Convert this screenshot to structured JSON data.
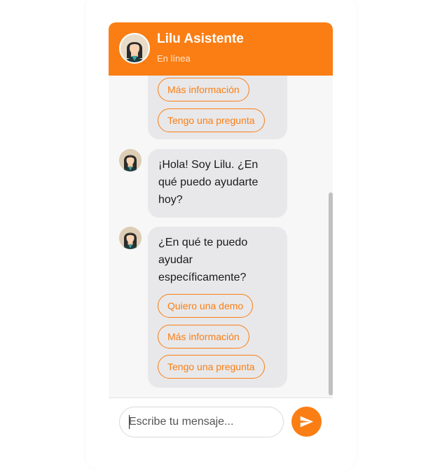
{
  "header": {
    "title": "Lilu Asistente",
    "status": "En línea"
  },
  "messages": {
    "top_partial_options": [
      "Más información",
      "Tengo una pregunta"
    ],
    "greeting": {
      "lines": [
        "¡Hola! Soy Lilu. ¿En",
        "qué puedo ayudarte",
        "hoy?"
      ]
    },
    "question": {
      "lines": [
        "¿En qué te puedo",
        "ayudar",
        "específicamente?"
      ],
      "options": [
        "Quiero una demo",
        "Más información",
        "Tengo una pregunta"
      ]
    }
  },
  "input": {
    "placeholder": "Escribe tu mensaje..."
  },
  "colors": {
    "accent": "#fa7e14",
    "bubble": "#e8e8ea"
  },
  "icons": {
    "avatar": "woman-avatar-icon",
    "send": "send-icon"
  }
}
